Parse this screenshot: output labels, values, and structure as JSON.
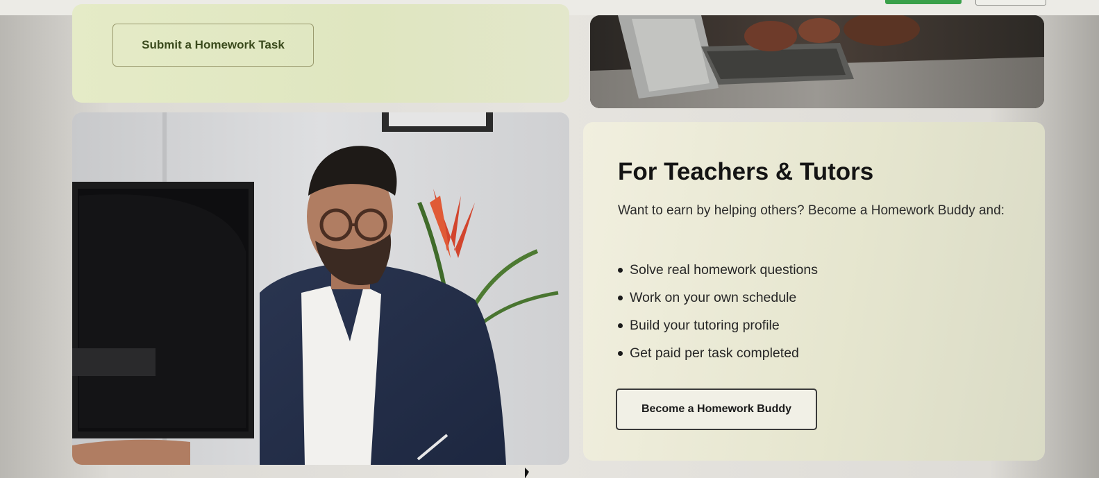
{
  "students_card": {
    "submit_button_label": "Submit a Homework Task"
  },
  "teachers_card": {
    "title": "For Teachers & Tutors",
    "intro": "Want to earn by helping others? Become a Homework Buddy and:",
    "benefits": [
      "Solve real homework questions",
      "Work on your own schedule",
      "Build your tutoring profile",
      "Get paid per task completed"
    ],
    "cta_label": "Become a Homework Buddy"
  },
  "images": {
    "laptop_photo": "laptop-typing-photo",
    "tutor_photo": "tutor-at-desk-photo"
  },
  "colors": {
    "card_green_tint": "#e5ebc7",
    "card_cream": "#f1efdf",
    "primary_green": "#3aa04a",
    "text_dark": "#141414"
  }
}
